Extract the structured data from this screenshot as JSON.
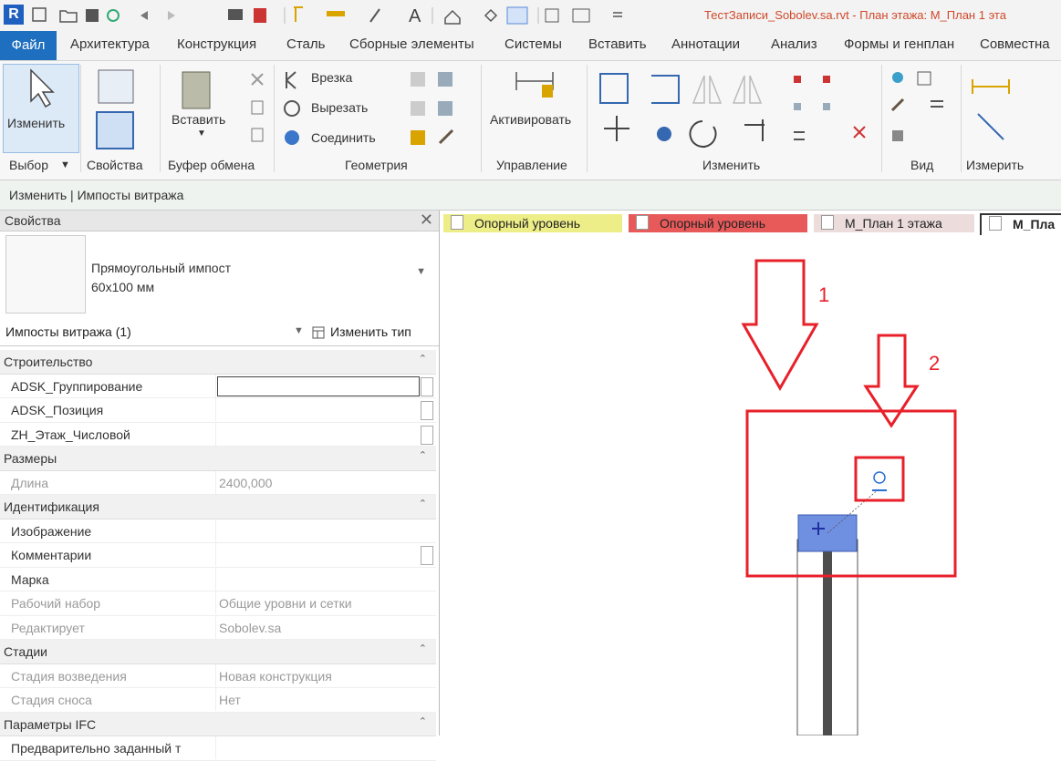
{
  "window": {
    "title": "ТестЗаписи_Sobolev.sa.rvt - План этажа: М_План 1 эта"
  },
  "ribbon_tabs": [
    "Файл",
    "Архитектура",
    "Конструкция",
    "Сталь",
    "Сборные элементы",
    "Системы",
    "Вставить",
    "Аннотации",
    "Анализ",
    "Формы и генплан",
    "Совместна"
  ],
  "ribbon": {
    "modify_label": "Изменить",
    "paste_label": "Вставить",
    "cut_label": "Врезка",
    "cutout_label": "Вырезать",
    "join_label": "Соединить",
    "activate_label": "Активировать",
    "panels": {
      "select": "Выбор",
      "properties": "Свойства",
      "clipboard": "Буфер обмена",
      "geometry": "Геометрия",
      "control": "Управление",
      "modify": "Изменить",
      "view": "Вид",
      "measure": "Измерить"
    }
  },
  "context_bar": "Изменить | Импосты витража",
  "properties": {
    "header": "Свойства",
    "close": "✕",
    "type_line1": "Прямоугольный импост",
    "type_line2": "60x100 мм",
    "filter": "Импосты витража (1)",
    "edit_type": "Изменить тип",
    "groups": [
      {
        "name": "Строительство",
        "rows": [
          {
            "key": "ADSK_Группирование",
            "value": "",
            "input": true,
            "check": true,
            "disabled": false
          },
          {
            "key": "ADSK_Позиция",
            "value": "",
            "input": false,
            "check": true,
            "disabled": false
          },
          {
            "key": "ZH_Этаж_Числовой",
            "value": "",
            "input": false,
            "check": true,
            "disabled": false
          }
        ]
      },
      {
        "name": "Размеры",
        "rows": [
          {
            "key": "Длина",
            "value": "2400,000",
            "input": false,
            "check": false,
            "disabled": true
          }
        ]
      },
      {
        "name": "Идентификация",
        "rows": [
          {
            "key": "Изображение",
            "value": "",
            "input": false,
            "check": false,
            "disabled": false
          },
          {
            "key": "Комментарии",
            "value": "",
            "input": false,
            "check": true,
            "disabled": false
          },
          {
            "key": "Марка",
            "value": "",
            "input": false,
            "check": false,
            "disabled": false
          },
          {
            "key": "Рабочий набор",
            "value": "Общие уровни и сетки",
            "input": false,
            "check": false,
            "disabled": true
          },
          {
            "key": "Редактирует",
            "value": "Sobolev.sa",
            "input": false,
            "check": false,
            "disabled": true
          }
        ]
      },
      {
        "name": "Стадии",
        "rows": [
          {
            "key": "Стадия возведения",
            "value": "Новая конструкция",
            "input": false,
            "check": false,
            "disabled": true
          },
          {
            "key": "Стадия сноса",
            "value": "Нет",
            "input": false,
            "check": false,
            "disabled": true
          }
        ]
      },
      {
        "name": "Параметры IFC",
        "rows": [
          {
            "key": "Предварительно заданный т",
            "value": "",
            "input": false,
            "check": false,
            "disabled": false
          }
        ]
      }
    ]
  },
  "view_tabs": [
    {
      "label": "Опорный уровень",
      "bg": "#eeee88"
    },
    {
      "label": "Опорный уровень",
      "bg": "#e85a5a"
    },
    {
      "label": "М_План 1 этажа",
      "bg": "#ecdcdc"
    },
    {
      "label": "М_Пла",
      "bg": "#ffffff"
    }
  ],
  "annotations": {
    "label1": "1",
    "label2": "2",
    "color": "#e8202a",
    "mullion_color": "#6f8fe0"
  }
}
